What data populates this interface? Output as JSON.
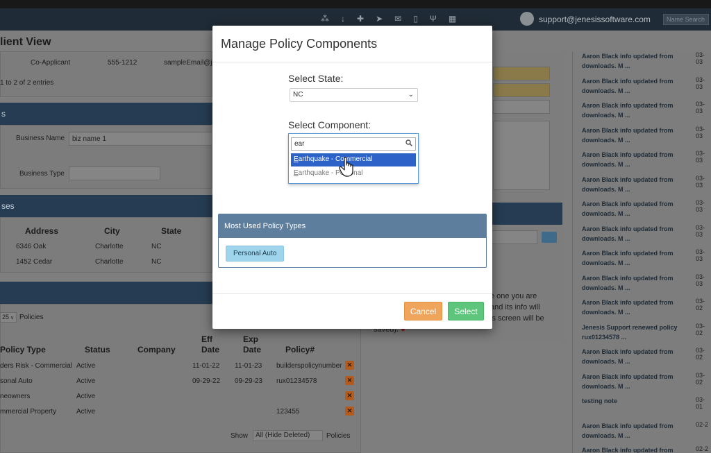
{
  "header": {
    "user_email": "support@jenesissoftware.com",
    "search_placeholder": "Name Search",
    "icons": [
      "handshake-icon",
      "download-icon",
      "add-user-icon",
      "send-icon",
      "mail-icon",
      "document-icon",
      "utensils-icon",
      "calendar-icon"
    ]
  },
  "background": {
    "page_title": "lient View",
    "coapplicant_row": {
      "role": "Co-Applicant",
      "phone": "555-1212",
      "email": "sampleEmail@je"
    },
    "entries_text": "1 to 2 of 2 entries",
    "business": {
      "name_label": "Business Name",
      "name_value": "biz name 1",
      "type_label": "Business Type"
    },
    "section_label_s": "s",
    "section_label_ses": "ses",
    "address_table": {
      "headers": [
        "Address",
        "City",
        "State"
      ],
      "rows": [
        {
          "address": "6346 Oak",
          "city": "Charlotte",
          "state": "NC"
        },
        {
          "address": "1452 Cedar",
          "city": "Charlotte",
          "state": "NC"
        }
      ]
    },
    "policies": {
      "page_size": "25",
      "page_size_suffix": "Policies",
      "headers": [
        "Policy Type",
        "Status",
        "Company",
        "Eff Date",
        "Exp Date",
        "Policy#"
      ],
      "header_lines": {
        "eff_1": "Eff",
        "eff_2": "Date",
        "exp_1": "Exp",
        "exp_2": "Date"
      },
      "rows": [
        {
          "type": "ders Risk - Commercial",
          "status": "Active",
          "company": "",
          "eff": "11-01-22",
          "exp": "11-01-23",
          "policy": "builderspolicynumber"
        },
        {
          "type": "sonal Auto",
          "status": "Active",
          "company": "",
          "eff": "09-29-22",
          "exp": "09-29-23",
          "policy": "rux01234578"
        },
        {
          "type": "neowners",
          "status": "Active",
          "company": "",
          "eff": "",
          "exp": "",
          "policy": ""
        },
        {
          "type": "mmercial Property",
          "status": "Active",
          "company": "",
          "eff": "",
          "exp": "",
          "policy": "123455"
        }
      ],
      "show_label": "Show",
      "show_value": "All (Hide Deleted)",
      "show_suffix": "Policies"
    },
    "middle_text": {
      "line1": "e one you are",
      "line2": "and its info will",
      "line3": "is screen will be",
      "line4": "saved)."
    },
    "notes": [
      {
        "text": "Aaron Black info updated from downloads. M ...",
        "date": "03-03"
      },
      {
        "text": "Aaron Black info updated from downloads. M ...",
        "date": "03-03"
      },
      {
        "text": "Aaron Black info updated from downloads. M ...",
        "date": "03-03"
      },
      {
        "text": "Aaron Black info updated from downloads. M ...",
        "date": "03-03"
      },
      {
        "text": "Aaron Black info updated from downloads. M ...",
        "date": "03-03"
      },
      {
        "text": "Aaron Black info updated from downloads. M ...",
        "date": "03-03"
      },
      {
        "text": "Aaron Black info updated from downloads. M ...",
        "date": "03-03"
      },
      {
        "text": "Aaron Black info updated from downloads. M ...",
        "date": "03-03"
      },
      {
        "text": "Aaron Black info updated from downloads. M ...",
        "date": "03-03"
      },
      {
        "text": "Aaron Black info updated from downloads. M ...",
        "date": "03-03"
      },
      {
        "text": "Aaron Black info updated from downloads. M ...",
        "date": "03-02"
      },
      {
        "text": "Jenesis Support renewed policy rux01234578 ...",
        "date": "03-02"
      },
      {
        "text": "Aaron Black info updated from downloads. M ...",
        "date": "03-02"
      },
      {
        "text": "Aaron Black info updated from downloads. M ...",
        "date": "03-02"
      },
      {
        "text": "testing note",
        "date": "03-01"
      },
      {
        "text": "Aaron Black info updated from downloads. M ...",
        "date": "02-2"
      },
      {
        "text": "Aaron Black info updated from downloads. M ...",
        "date": "02-2"
      }
    ]
  },
  "modal": {
    "title": "Manage Policy Components",
    "state_label": "Select State:",
    "state_value": "NC",
    "component_label": "Select Component:",
    "search_value": "ear",
    "options": [
      {
        "label": "Earthquake - Commercial",
        "selected": true
      },
      {
        "label": "Earthquake - Personal",
        "selected": false
      }
    ],
    "most_used_header": "Most Used Policy Types",
    "most_used_items": [
      "Personal Auto"
    ],
    "cancel_label": "Cancel",
    "select_label": "Select"
  },
  "colors": {
    "select_button": "#5ec57c",
    "cancel_button": "#f0a55d",
    "option_highlight": "#2d63c8",
    "panel_header": "#5e7e9d"
  }
}
